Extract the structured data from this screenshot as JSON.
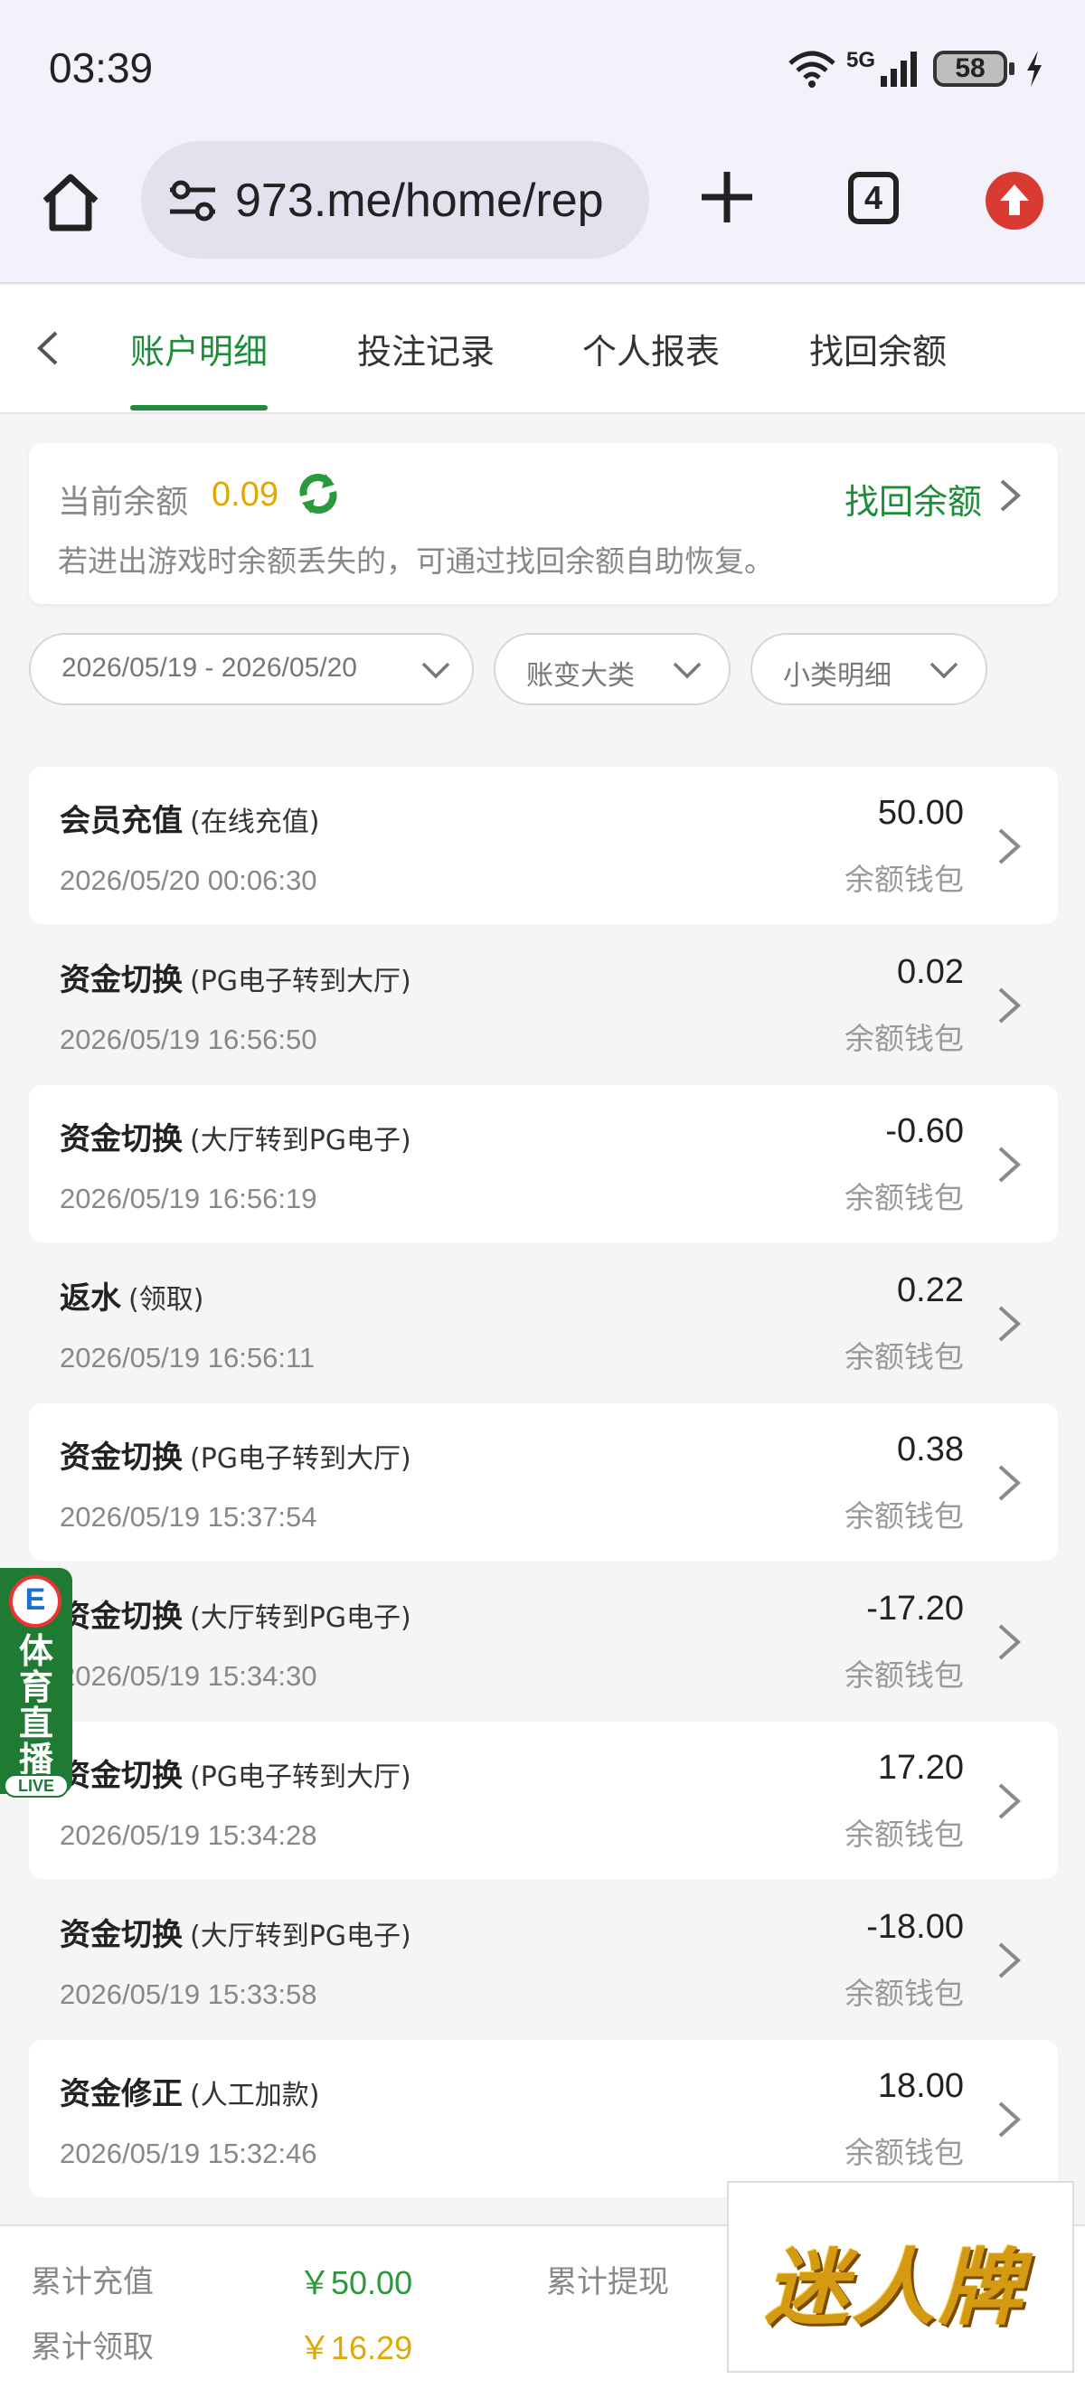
{
  "status_bar": {
    "time": "03:39",
    "network": "5G",
    "battery": "58"
  },
  "browser": {
    "url": "973.me/home/rep",
    "tab_count": "4"
  },
  "nav": {
    "tabs": [
      {
        "label": "账户明细",
        "active": true
      },
      {
        "label": "投注记录",
        "active": false
      },
      {
        "label": "个人报表",
        "active": false
      },
      {
        "label": "找回余额",
        "active": false
      }
    ]
  },
  "balance": {
    "label": "当前余额",
    "value": "0.09",
    "recover_label": "找回余额",
    "tip": "若进出游戏时余额丢失的，可通过找回余额自助恢复。"
  },
  "filters": {
    "date_range": "2026/05/19 - 2026/05/20",
    "category": "账变大类",
    "subcategory": "小类明细"
  },
  "records": [
    {
      "title": "会员充值",
      "sub": "(在线充值)",
      "time": "2026/05/20 00:06:30",
      "amount": "50.00",
      "wallet": "余额钱包"
    },
    {
      "title": "资金切换",
      "sub": "(PG电子转到大厅)",
      "time": "2026/05/19 16:56:50",
      "amount": "0.02",
      "wallet": "余额钱包"
    },
    {
      "title": "资金切换",
      "sub": "(大厅转到PG电子)",
      "time": "2026/05/19 16:56:19",
      "amount": "-0.60",
      "wallet": "余额钱包"
    },
    {
      "title": "返水",
      "sub": "(领取)",
      "time": "2026/05/19 16:56:11",
      "amount": "0.22",
      "wallet": "余额钱包"
    },
    {
      "title": "资金切换",
      "sub": "(PG电子转到大厅)",
      "time": "2026/05/19 15:37:54",
      "amount": "0.38",
      "wallet": "余额钱包"
    },
    {
      "title": "资金切换",
      "sub": "(大厅转到PG电子)",
      "time": "2026/05/19 15:34:30",
      "amount": "-17.20",
      "wallet": "余额钱包"
    },
    {
      "title": "资金切换",
      "sub": "(PG电子转到大厅)",
      "time": "2026/05/19 15:34:28",
      "amount": "17.20",
      "wallet": "余额钱包"
    },
    {
      "title": "资金切换",
      "sub": "(大厅转到PG电子)",
      "time": "2026/05/19 15:33:58",
      "amount": "-18.00",
      "wallet": "余额钱包"
    },
    {
      "title": "资金修正",
      "sub": "(人工加款)",
      "time": "2026/05/19 15:32:46",
      "amount": "18.00",
      "wallet": "余额钱包"
    }
  ],
  "live_badge": {
    "text": "体育直播",
    "tag": "LIVE"
  },
  "summary": {
    "total_recharge_label": "累计充值",
    "total_recharge_value": "￥50.00",
    "total_withdraw_label": "累计提现",
    "total_claim_label": "累计领取",
    "total_claim_value": "￥16.29"
  },
  "ad": {
    "text": "迷人牌"
  },
  "colors": {
    "accent_green": "#1e8c3a",
    "gold": "#e0a800",
    "status_red": "#d93a32"
  }
}
